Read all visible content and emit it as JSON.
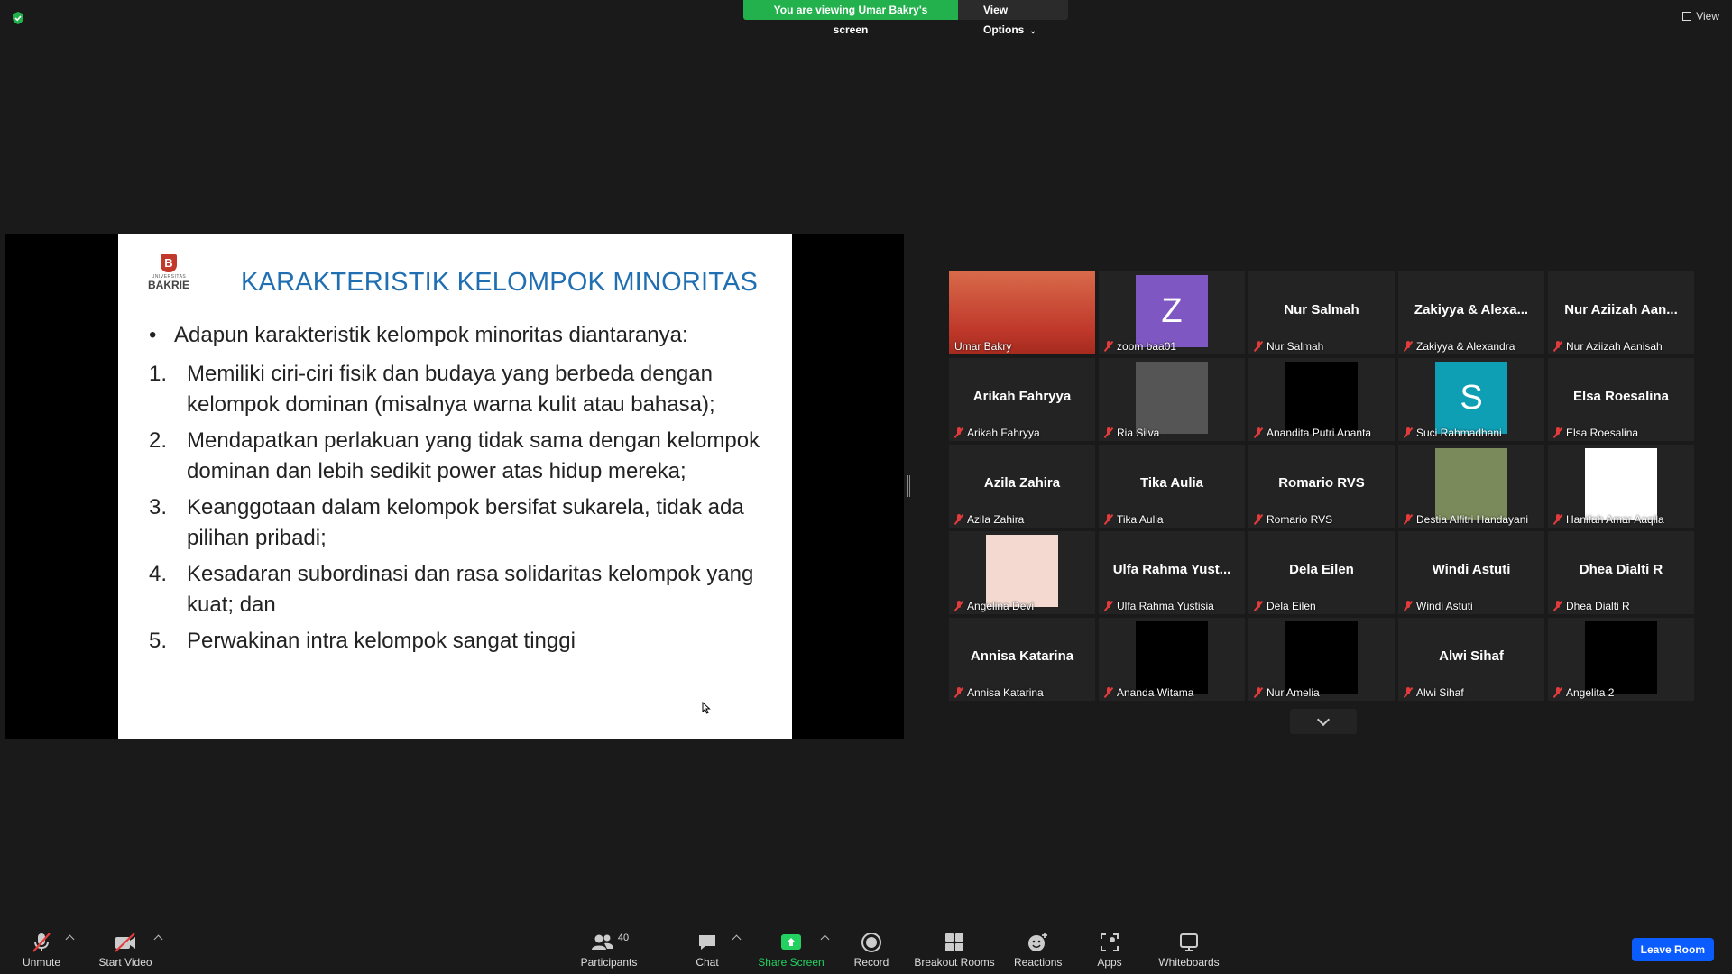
{
  "top": {
    "viewing_banner": "You are viewing Umar Bakry's screen",
    "view_options": "View Options",
    "view_button": "View"
  },
  "slide": {
    "logo_university": "UNIVERSITAS",
    "logo_name": "BAKRIE",
    "logo_crest": "B",
    "title": "KARAKTERISTIK KELOMPOK MINORITAS",
    "intro": "Adapun karakteristik kelompok minoritas diantaranya:",
    "items": [
      {
        "num": "1.",
        "text": "Memiliki ciri-ciri fisik dan budaya yang berbeda dengan kelompok dominan (misalnya warna kulit atau bahasa);"
      },
      {
        "num": "2.",
        "text": "Mendapatkan perlakuan yang tidak sama dengan kelompok dominan dan lebih sedikit power atas hidup mereka;"
      },
      {
        "num": "3.",
        "text": "Keanggotaan dalam kelompok bersifat sukarela, tidak ada pilihan pribadi;"
      },
      {
        "num": "4.",
        "text": "Kesadaran subordinasi dan rasa solidaritas kelompok yang kuat; dan"
      },
      {
        "num": "5.",
        "text": "Perwakinan intra kelompok sangat tinggi"
      }
    ]
  },
  "participants": [
    {
      "name": "Umar Bakry",
      "display": "",
      "kind": "photo",
      "color": "#c0392b",
      "active": true,
      "muted": false
    },
    {
      "name": "zoom baa01",
      "display": "Z",
      "kind": "letter",
      "color": "#7e57c2",
      "muted": true
    },
    {
      "name": "Nur Salmah",
      "display": "Nur Salmah",
      "kind": "text",
      "muted": true
    },
    {
      "name": "Zakiyya & Alexandra",
      "display": "Zakiyya & Alexa...",
      "kind": "text",
      "muted": true
    },
    {
      "name": "Nur Aziizah Aanisah",
      "display": "Nur Aziizah Aan...",
      "kind": "text",
      "muted": true
    },
    {
      "name": "Arikah Fahryya",
      "display": "Arikah Fahryya",
      "kind": "text",
      "muted": true
    },
    {
      "name": "Ria Silva",
      "display": "",
      "kind": "avatar",
      "color": "#555555",
      "muted": true
    },
    {
      "name": "Anandita Putri Ananta",
      "display": "",
      "kind": "avatar",
      "color": "#000000",
      "muted": true
    },
    {
      "name": "Suci Rahmadhani",
      "display": "S",
      "kind": "letter",
      "color": "#0e9fb5",
      "muted": true
    },
    {
      "name": "Elsa Roesalina",
      "display": "Elsa Roesalina",
      "kind": "text",
      "muted": true
    },
    {
      "name": "Azila Zahira",
      "display": "Azila Zahira",
      "kind": "text",
      "muted": true
    },
    {
      "name": "Tika Aulia",
      "display": "Tika Aulia",
      "kind": "text",
      "muted": true
    },
    {
      "name": "Romario RVS",
      "display": "Romario RVS",
      "kind": "text",
      "muted": true
    },
    {
      "name": "Destia Alfitri Handayani",
      "display": "",
      "kind": "avatar",
      "color": "#7a8a5a",
      "muted": true
    },
    {
      "name": "Hanifah Amar Aaqila",
      "display": "",
      "kind": "avatar",
      "color": "#ffffff",
      "muted": true
    },
    {
      "name": "Angelina Devi",
      "display": "",
      "kind": "avatar",
      "color": "#f4d9d0",
      "muted": true
    },
    {
      "name": "Ulfa Rahma Yustisia",
      "display": "Ulfa Rahma Yust...",
      "kind": "text",
      "muted": true
    },
    {
      "name": "Dela Eilen",
      "display": "Dela Eilen",
      "kind": "text",
      "muted": true
    },
    {
      "name": "Windi Astuti",
      "display": "Windi Astuti",
      "kind": "text",
      "muted": true
    },
    {
      "name": "Dhea Dialti R",
      "display": "Dhea Dialti R",
      "kind": "text",
      "muted": true
    },
    {
      "name": "Annisa Katarina",
      "display": "Annisa Katarina",
      "kind": "text",
      "muted": true
    },
    {
      "name": "Ananda Witama",
      "display": "",
      "kind": "avatar",
      "color": "#000000",
      "muted": true
    },
    {
      "name": "Nur Amelia",
      "display": "",
      "kind": "avatar",
      "color": "#000000",
      "muted": true
    },
    {
      "name": "Alwi Sihaf",
      "display": "Alwi Sihaf",
      "kind": "text",
      "muted": true
    },
    {
      "name": "Angelita 2",
      "display": "",
      "kind": "avatar",
      "color": "#000000",
      "muted": true
    }
  ],
  "toolbar": {
    "unmute": "Unmute",
    "start_video": "Start Video",
    "participants": "Participants",
    "participants_count": "40",
    "chat": "Chat",
    "share_screen": "Share Screen",
    "record": "Record",
    "breakout_rooms": "Breakout Rooms",
    "reactions": "Reactions",
    "apps": "Apps",
    "whiteboards": "Whiteboards",
    "leave_room": "Leave Room"
  },
  "colors": {
    "share_green": "#23b14d",
    "active_speaker": "#c8e63c",
    "leave_blue": "#0b5cff",
    "slide_title": "#1f6fb2"
  }
}
